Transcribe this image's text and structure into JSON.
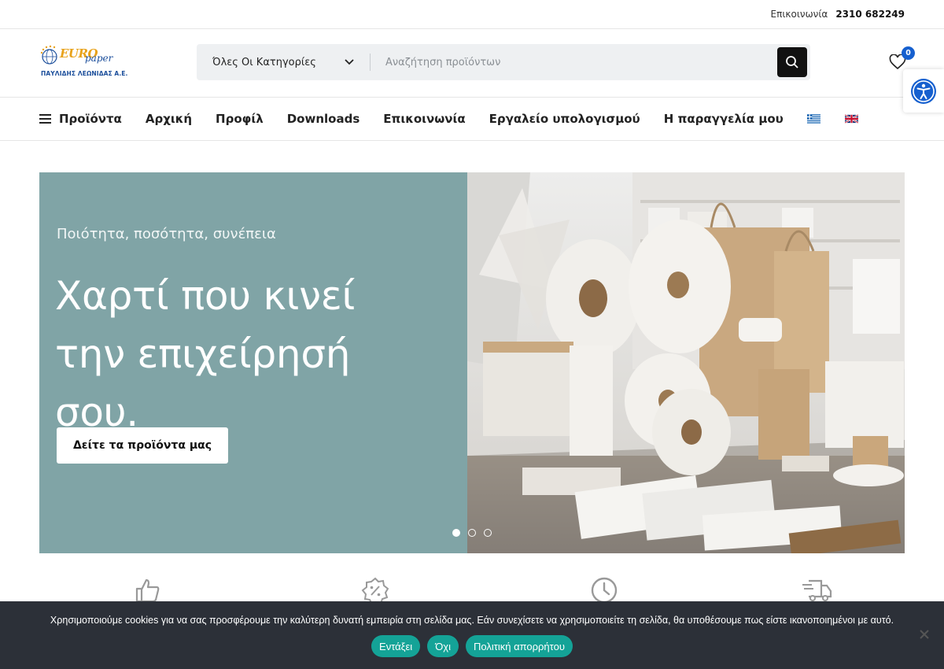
{
  "topbar": {
    "contact_label": "Επικοινωνία",
    "phone": "2310 682249"
  },
  "logo": {
    "euro": "EURO",
    "paper": "paper",
    "subtitle": "ΠΑΥΛΙΔΗΣ ΛΕΩΝΙΔΑΣ Α.Ε."
  },
  "search": {
    "category": "Όλες Οι Κατηγορίες",
    "placeholder": "Αναζήτηση προϊόντων"
  },
  "wishlist": {
    "count": "0"
  },
  "nav": {
    "products": "Προϊόντα",
    "items": [
      "Αρχική",
      "Προφίλ",
      "Downloads",
      "Επικοινωνία",
      "Εργαλείο υπολογισμού",
      "Η παραγγελία μου"
    ]
  },
  "hero": {
    "tagline": "Ποιότητα, ποσότητα, συνέπεια",
    "title": "Χαρτί που κινεί την επιχείρησή σου.",
    "cta": "Δείτε τα προϊόντα μας",
    "slide_count": 3,
    "active_slide": 1
  },
  "features": {
    "icons": [
      "thumbs-up-icon",
      "discount-badge-icon",
      "clock-icon",
      "delivery-truck-icon"
    ]
  },
  "cookie": {
    "message": "Χρησιμοποιούμε cookies για να σας προσφέρουμε την καλύτερη δυνατή εμπειρία στη σελίδα μας. Εάν συνεχίσετε να χρησιμοποιείτε τη σελίδα, θα υποθέσουμε πως είστε ικανοποιημένοι με αυτό.",
    "accept": "Εντάξει",
    "decline": "Όχι",
    "policy": "Πολιτική απορρήτου"
  },
  "colors": {
    "hero_bg": "#80a4a6",
    "accent_teal": "#14a397",
    "badge_blue": "#1660cf",
    "cookie_bg": "#2c3038"
  }
}
